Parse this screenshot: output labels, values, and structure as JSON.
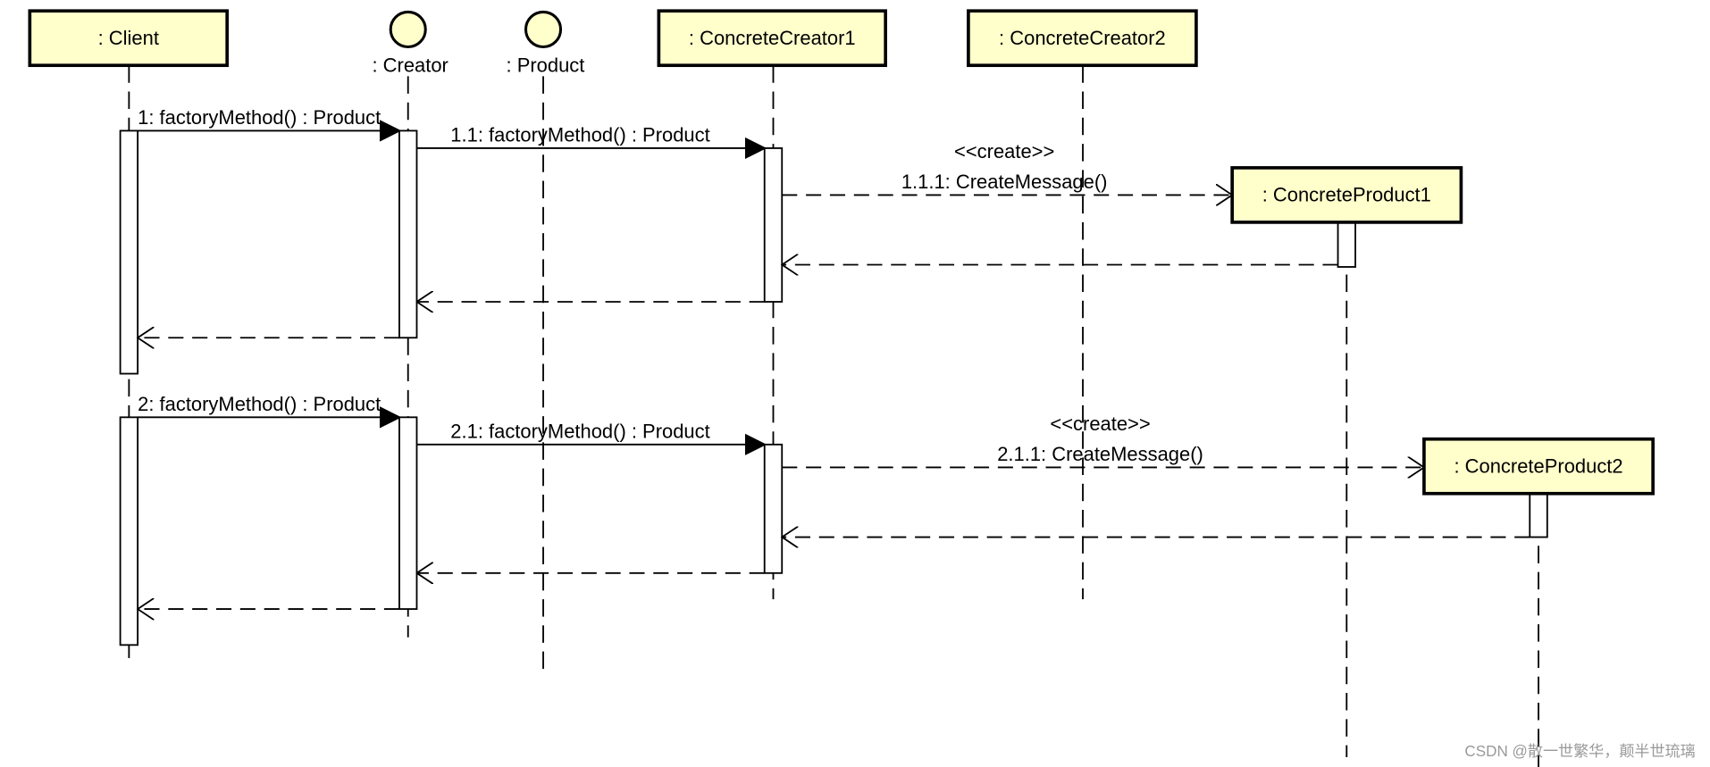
{
  "colors": {
    "participant_fill": "#ffffcc",
    "stroke": "#000000",
    "watermark": "#9a9a9a"
  },
  "participants": [
    {
      "id": "client",
      "label": ": Client",
      "kind": "object"
    },
    {
      "id": "creator",
      "label": ": Creator",
      "kind": "interface"
    },
    {
      "id": "product",
      "label": ": Product",
      "kind": "interface"
    },
    {
      "id": "cc1",
      "label": ": ConcreteCreator1",
      "kind": "object"
    },
    {
      "id": "cc2",
      "label": ": ConcreteCreator2",
      "kind": "object"
    },
    {
      "id": "cp1",
      "label": ": ConcreteProduct1",
      "kind": "created-object"
    },
    {
      "id": "cp2",
      "label": ": ConcreteProduct2",
      "kind": "created-object"
    }
  ],
  "messages": [
    {
      "from": "client",
      "to": "creator",
      "label": "1: factoryMethod() : Product",
      "type": "sync"
    },
    {
      "from": "creator",
      "to": "cc1",
      "label": "1.1: factoryMethod() : Product",
      "type": "sync"
    },
    {
      "from": "cc1",
      "to": "cp1",
      "stereotype": "<<create>>",
      "label": "1.1.1: CreateMessage()",
      "type": "create"
    },
    {
      "from": "cp1",
      "to": "cc1",
      "label": "",
      "type": "return"
    },
    {
      "from": "cc1",
      "to": "creator",
      "label": "",
      "type": "return"
    },
    {
      "from": "creator",
      "to": "client",
      "label": "",
      "type": "return"
    },
    {
      "from": "client",
      "to": "creator",
      "label": "2: factoryMethod() : Product",
      "type": "sync"
    },
    {
      "from": "creator",
      "to": "cc1",
      "label": "2.1: factoryMethod() : Product",
      "type": "sync"
    },
    {
      "from": "cc1",
      "to": "cp2",
      "stereotype": "<<create>>",
      "label": "2.1.1: CreateMessage()",
      "type": "create"
    },
    {
      "from": "cp2",
      "to": "cc1",
      "label": "",
      "type": "return"
    },
    {
      "from": "cc1",
      "to": "creator",
      "label": "",
      "type": "return"
    },
    {
      "from": "creator",
      "to": "client",
      "label": "",
      "type": "return"
    }
  ],
  "watermark": "CSDN @散一世繁华，颠半世琉璃"
}
